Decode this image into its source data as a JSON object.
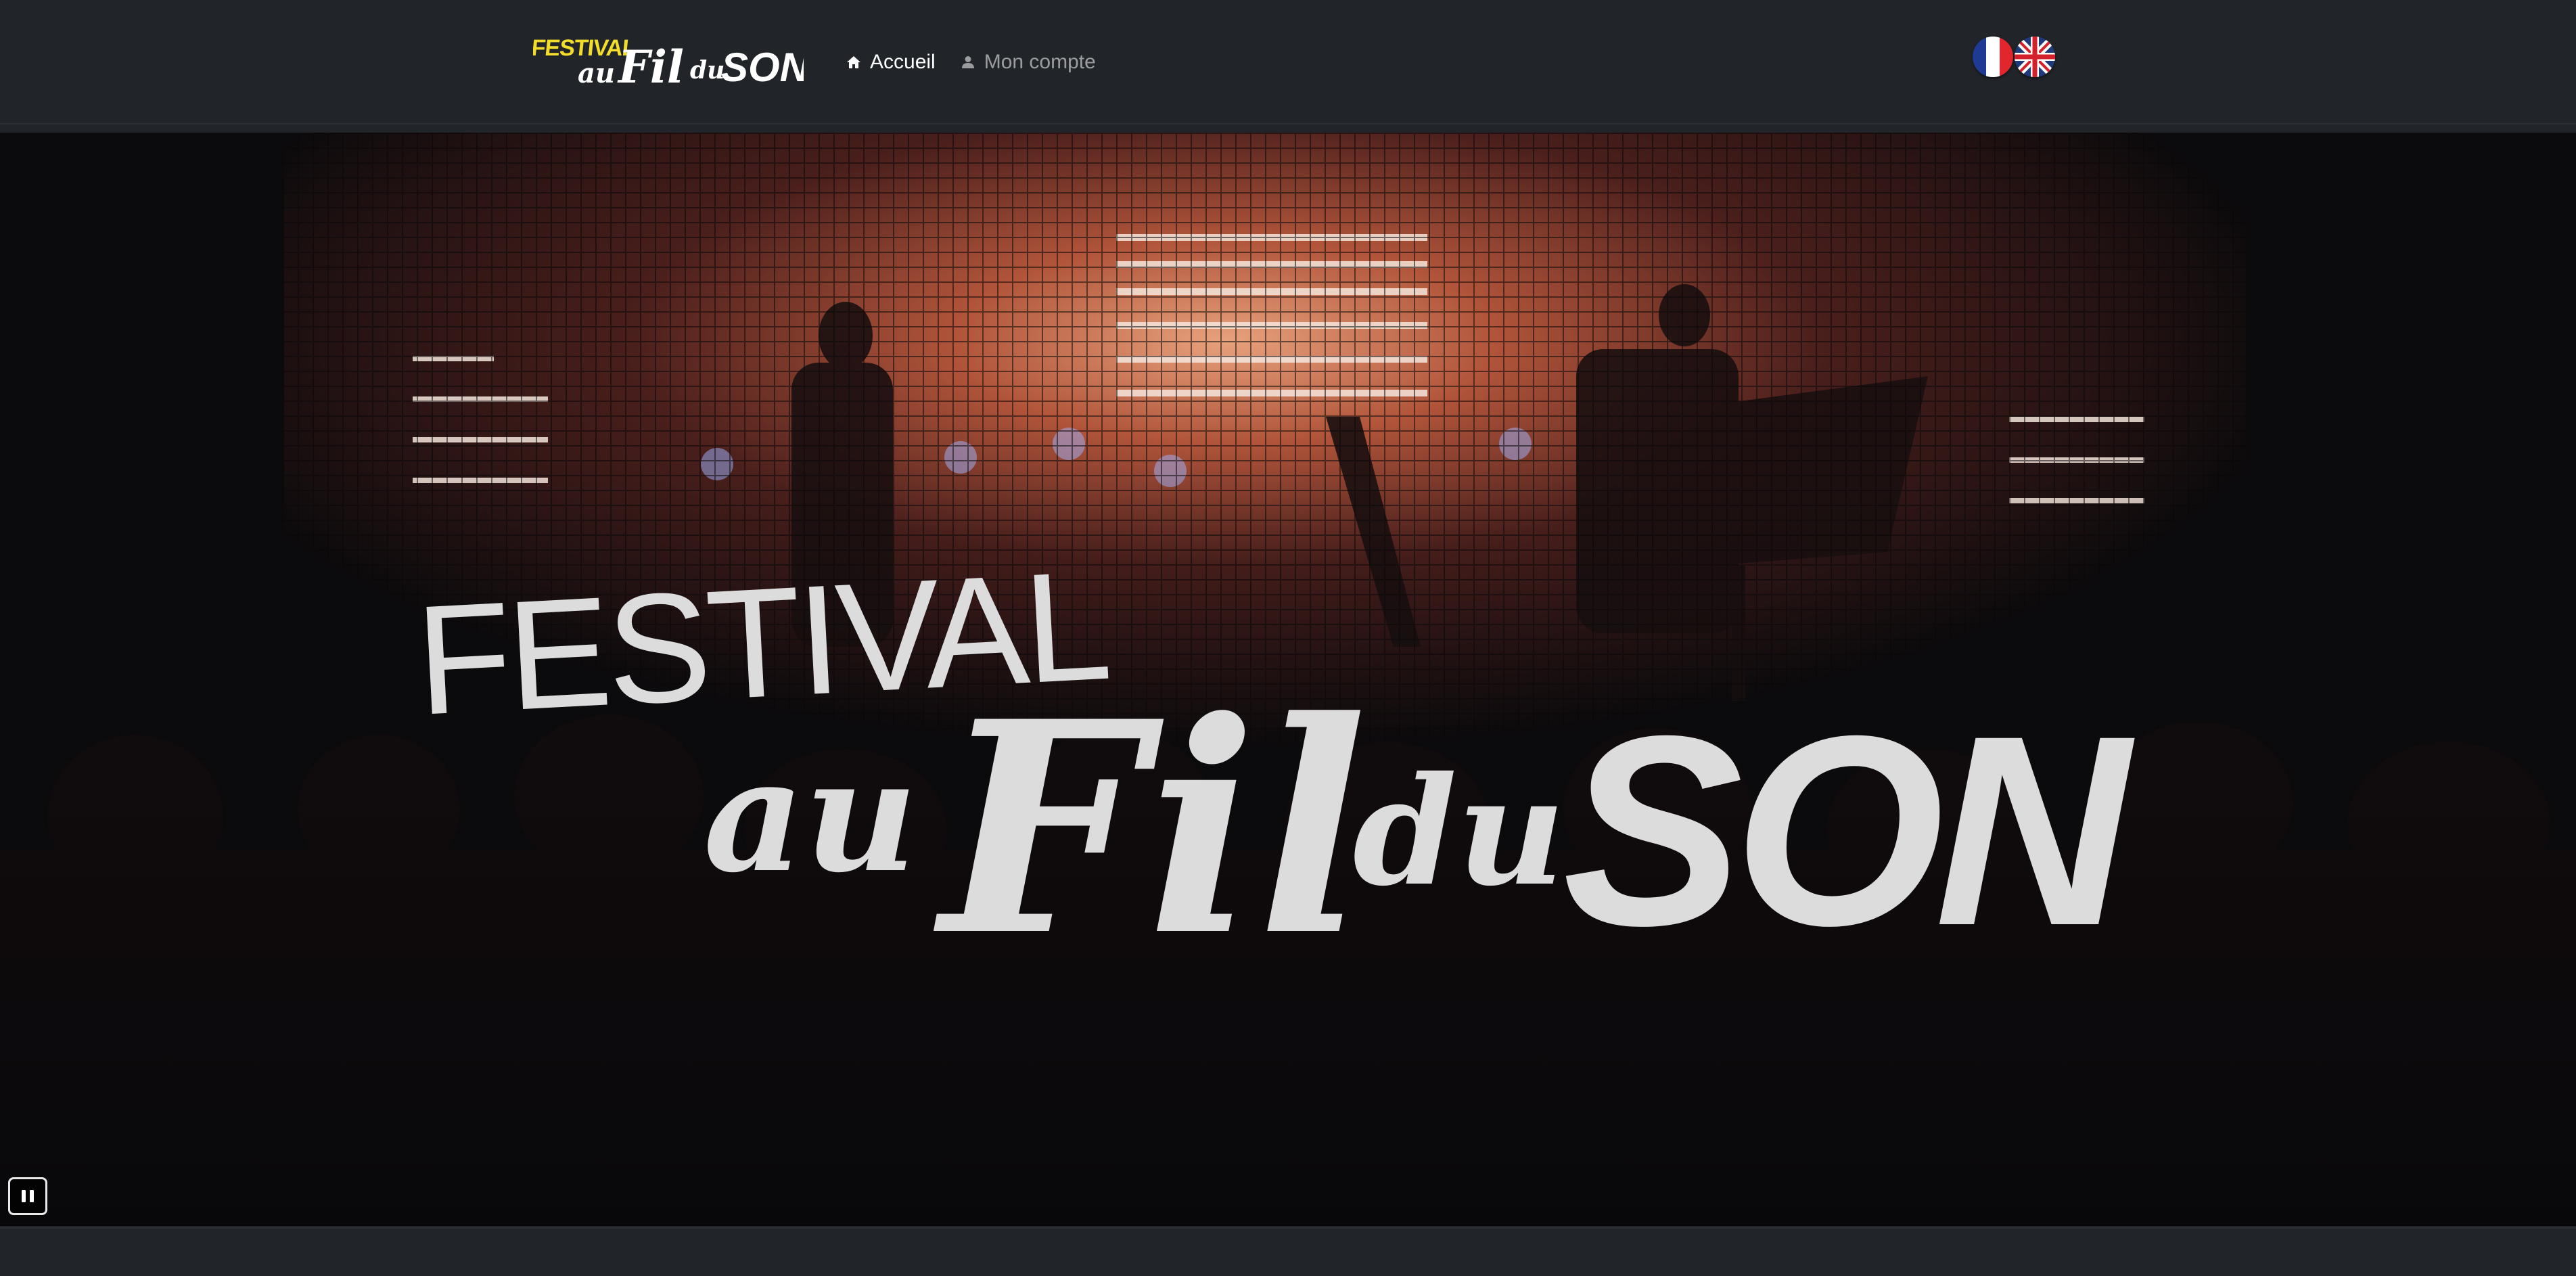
{
  "header": {
    "logo": {
      "line1": "FESTIVAL",
      "line2": "au",
      "line3": "Fil",
      "line4": "du",
      "line5": "SON"
    },
    "nav": [
      {
        "label": "Accueil",
        "icon": "home-icon",
        "active": true
      },
      {
        "label": "Mon compte",
        "icon": "user-icon",
        "active": false
      }
    ],
    "languages": [
      {
        "code": "fr",
        "icon": "flag-france-icon"
      },
      {
        "code": "en",
        "icon": "flag-uk-icon"
      }
    ]
  },
  "hero": {
    "title": {
      "line1": "FESTIVAL",
      "line2": "au",
      "line3": "Fil",
      "line4": "du",
      "line5": "SON"
    },
    "media": "concert-video-background",
    "controls": {
      "pause_icon": "pause-icon"
    }
  },
  "colors": {
    "navbar": "#212529",
    "logo_yellow": "#f2dd2a",
    "title_text": "#dcdcdc",
    "stage_glow": "#b0543a"
  }
}
